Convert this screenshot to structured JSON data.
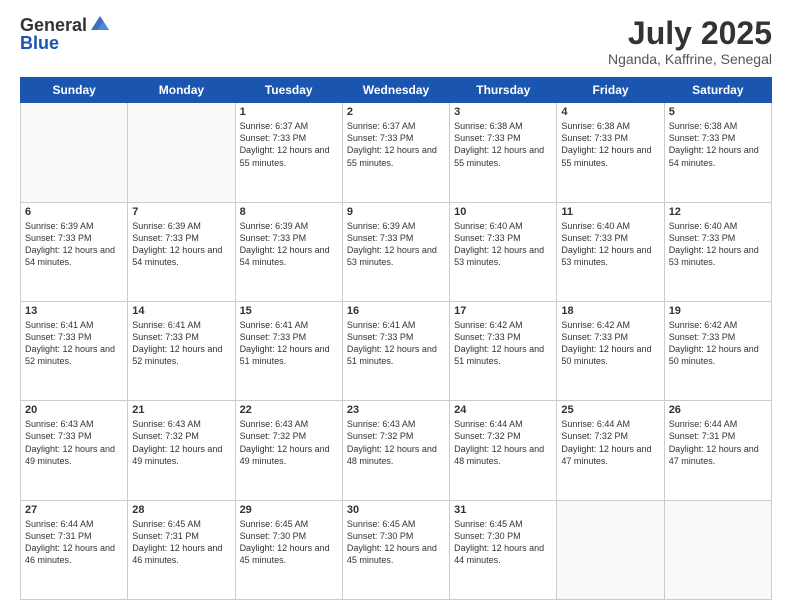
{
  "header": {
    "logo": {
      "general": "General",
      "blue": "Blue"
    },
    "title": "July 2025",
    "location": "Nganda, Kaffrine, Senegal"
  },
  "calendar": {
    "days_of_week": [
      "Sunday",
      "Monday",
      "Tuesday",
      "Wednesday",
      "Thursday",
      "Friday",
      "Saturday"
    ],
    "weeks": [
      [
        {
          "day": "",
          "info": ""
        },
        {
          "day": "",
          "info": ""
        },
        {
          "day": "1",
          "info": "Sunrise: 6:37 AM\nSunset: 7:33 PM\nDaylight: 12 hours and 55 minutes."
        },
        {
          "day": "2",
          "info": "Sunrise: 6:37 AM\nSunset: 7:33 PM\nDaylight: 12 hours and 55 minutes."
        },
        {
          "day": "3",
          "info": "Sunrise: 6:38 AM\nSunset: 7:33 PM\nDaylight: 12 hours and 55 minutes."
        },
        {
          "day": "4",
          "info": "Sunrise: 6:38 AM\nSunset: 7:33 PM\nDaylight: 12 hours and 55 minutes."
        },
        {
          "day": "5",
          "info": "Sunrise: 6:38 AM\nSunset: 7:33 PM\nDaylight: 12 hours and 54 minutes."
        }
      ],
      [
        {
          "day": "6",
          "info": "Sunrise: 6:39 AM\nSunset: 7:33 PM\nDaylight: 12 hours and 54 minutes."
        },
        {
          "day": "7",
          "info": "Sunrise: 6:39 AM\nSunset: 7:33 PM\nDaylight: 12 hours and 54 minutes."
        },
        {
          "day": "8",
          "info": "Sunrise: 6:39 AM\nSunset: 7:33 PM\nDaylight: 12 hours and 54 minutes."
        },
        {
          "day": "9",
          "info": "Sunrise: 6:39 AM\nSunset: 7:33 PM\nDaylight: 12 hours and 53 minutes."
        },
        {
          "day": "10",
          "info": "Sunrise: 6:40 AM\nSunset: 7:33 PM\nDaylight: 12 hours and 53 minutes."
        },
        {
          "day": "11",
          "info": "Sunrise: 6:40 AM\nSunset: 7:33 PM\nDaylight: 12 hours and 53 minutes."
        },
        {
          "day": "12",
          "info": "Sunrise: 6:40 AM\nSunset: 7:33 PM\nDaylight: 12 hours and 53 minutes."
        }
      ],
      [
        {
          "day": "13",
          "info": "Sunrise: 6:41 AM\nSunset: 7:33 PM\nDaylight: 12 hours and 52 minutes."
        },
        {
          "day": "14",
          "info": "Sunrise: 6:41 AM\nSunset: 7:33 PM\nDaylight: 12 hours and 52 minutes."
        },
        {
          "day": "15",
          "info": "Sunrise: 6:41 AM\nSunset: 7:33 PM\nDaylight: 12 hours and 51 minutes."
        },
        {
          "day": "16",
          "info": "Sunrise: 6:41 AM\nSunset: 7:33 PM\nDaylight: 12 hours and 51 minutes."
        },
        {
          "day": "17",
          "info": "Sunrise: 6:42 AM\nSunset: 7:33 PM\nDaylight: 12 hours and 51 minutes."
        },
        {
          "day": "18",
          "info": "Sunrise: 6:42 AM\nSunset: 7:33 PM\nDaylight: 12 hours and 50 minutes."
        },
        {
          "day": "19",
          "info": "Sunrise: 6:42 AM\nSunset: 7:33 PM\nDaylight: 12 hours and 50 minutes."
        }
      ],
      [
        {
          "day": "20",
          "info": "Sunrise: 6:43 AM\nSunset: 7:33 PM\nDaylight: 12 hours and 49 minutes."
        },
        {
          "day": "21",
          "info": "Sunrise: 6:43 AM\nSunset: 7:32 PM\nDaylight: 12 hours and 49 minutes."
        },
        {
          "day": "22",
          "info": "Sunrise: 6:43 AM\nSunset: 7:32 PM\nDaylight: 12 hours and 49 minutes."
        },
        {
          "day": "23",
          "info": "Sunrise: 6:43 AM\nSunset: 7:32 PM\nDaylight: 12 hours and 48 minutes."
        },
        {
          "day": "24",
          "info": "Sunrise: 6:44 AM\nSunset: 7:32 PM\nDaylight: 12 hours and 48 minutes."
        },
        {
          "day": "25",
          "info": "Sunrise: 6:44 AM\nSunset: 7:32 PM\nDaylight: 12 hours and 47 minutes."
        },
        {
          "day": "26",
          "info": "Sunrise: 6:44 AM\nSunset: 7:31 PM\nDaylight: 12 hours and 47 minutes."
        }
      ],
      [
        {
          "day": "27",
          "info": "Sunrise: 6:44 AM\nSunset: 7:31 PM\nDaylight: 12 hours and 46 minutes."
        },
        {
          "day": "28",
          "info": "Sunrise: 6:45 AM\nSunset: 7:31 PM\nDaylight: 12 hours and 46 minutes."
        },
        {
          "day": "29",
          "info": "Sunrise: 6:45 AM\nSunset: 7:30 PM\nDaylight: 12 hours and 45 minutes."
        },
        {
          "day": "30",
          "info": "Sunrise: 6:45 AM\nSunset: 7:30 PM\nDaylight: 12 hours and 45 minutes."
        },
        {
          "day": "31",
          "info": "Sunrise: 6:45 AM\nSunset: 7:30 PM\nDaylight: 12 hours and 44 minutes."
        },
        {
          "day": "",
          "info": ""
        },
        {
          "day": "",
          "info": ""
        }
      ]
    ]
  }
}
